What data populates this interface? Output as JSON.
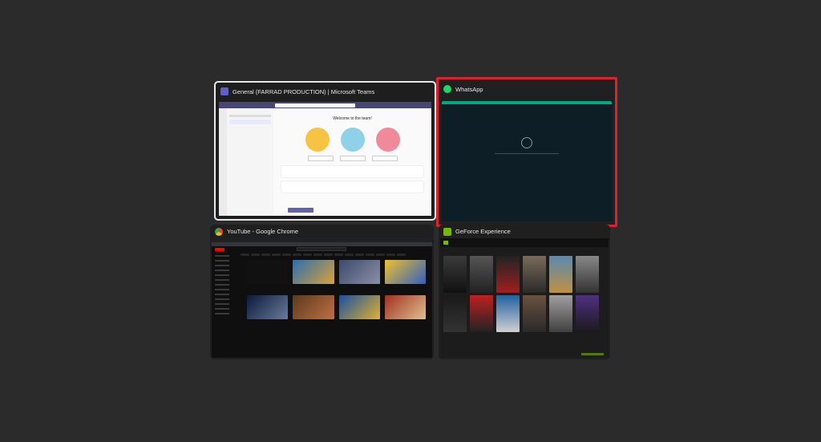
{
  "windows": {
    "teams": {
      "title": "General (FARRAD PRODUCTION) | Microsoft Teams",
      "icon": "teams-icon",
      "accent": "#6264a7",
      "welcome": "Welcome to the team!"
    },
    "whatsapp": {
      "title": "WhatsApp",
      "icon": "whatsapp-icon",
      "accent": "#00a884",
      "selected": true,
      "highlight_color": "#d9232e"
    },
    "chrome": {
      "title": "YouTube - Google Chrome",
      "icon": "chrome-icon",
      "accent": "#ff0000"
    },
    "geforce": {
      "title": "GeForce Experience",
      "icon": "nvidia-icon",
      "accent": "#76b900"
    }
  }
}
